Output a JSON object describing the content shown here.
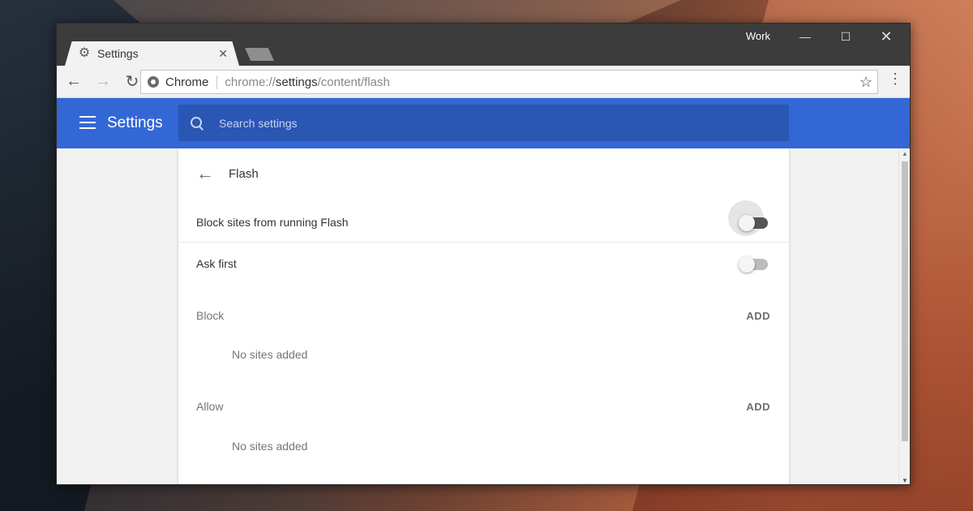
{
  "window": {
    "profile": "Work",
    "controls": {
      "minimize": "—",
      "maximize": "☐",
      "close": "✕"
    }
  },
  "tab": {
    "title": "Settings",
    "icon": "gear-icon",
    "close": "✕"
  },
  "toolbar": {
    "back": "←",
    "forward": "→",
    "reload": "↻",
    "omnibox_chip": "Chrome",
    "url_prefix": "chrome://",
    "url_host": "settings",
    "url_path": "/content/flash",
    "star": "☆",
    "menu": "⋮"
  },
  "header": {
    "title": "Settings",
    "search_placeholder": "Search settings"
  },
  "card": {
    "back": "←",
    "title": "Flash",
    "rows": [
      {
        "label": "Block sites from running Flash",
        "enabled": true
      },
      {
        "label": "Ask first",
        "enabled": false
      }
    ],
    "sections": [
      {
        "label": "Block",
        "action": "ADD",
        "empty": "No sites added"
      },
      {
        "label": "Allow",
        "action": "ADD",
        "empty": "No sites added"
      }
    ]
  },
  "scrollbar": {
    "up": "▲",
    "down": "▼"
  },
  "colors": {
    "header_blue": "#3367d6",
    "search_blue": "#2a56b4",
    "titlebar": "#3c3c3c"
  }
}
